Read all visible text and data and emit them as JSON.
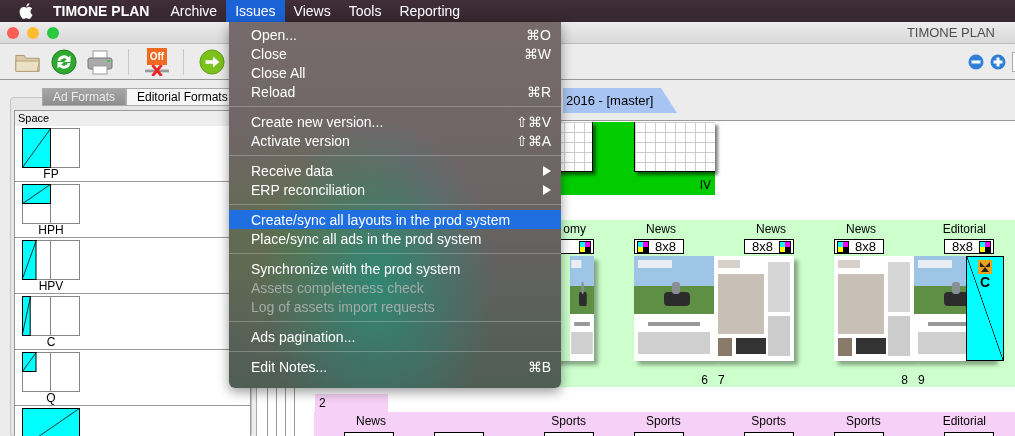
{
  "menubar": {
    "app": "TIMONE PLAN",
    "menus": [
      {
        "label": "Archive",
        "selected": false
      },
      {
        "label": "Issues",
        "selected": true
      },
      {
        "label": "Views",
        "selected": false
      },
      {
        "label": "Tools",
        "selected": false
      },
      {
        "label": "Reporting",
        "selected": false
      }
    ]
  },
  "window": {
    "title": "TIMONE PLAN"
  },
  "toolbar": {
    "offline_label": "Off"
  },
  "left_panel": {
    "tabs": [
      {
        "label": "Ad Formats",
        "selected": true
      },
      {
        "label": "Editorial Formats",
        "selected": false
      }
    ],
    "column": "Space",
    "formats": [
      {
        "kind": "fp",
        "label": "FP"
      },
      {
        "kind": "hph",
        "label": "HPH"
      },
      {
        "kind": "hpv",
        "label": "HPV"
      },
      {
        "kind": "c",
        "label": "C"
      },
      {
        "kind": "q",
        "label": "Q"
      },
      {
        "kind": "spread"
      }
    ]
  },
  "issue_tab": {
    "label": "2016 - [master]",
    "selected": true
  },
  "row_1": {
    "label": "IV"
  },
  "row_2": {
    "pages": [
      {
        "section": "omy"
      },
      {
        "section": "News",
        "badge": "8x8",
        "number": "6"
      },
      {
        "section": "News",
        "badge": "8x8",
        "number": "7"
      },
      {
        "section": "News",
        "badge": "8x8",
        "number": "8"
      },
      {
        "section": "Editorial",
        "badge": "8x8",
        "number": "9",
        "ad": {
          "label": "C"
        }
      }
    ]
  },
  "row_3": {
    "label": "2",
    "pages": [
      {
        "kind": "labelled",
        "section": "News"
      },
      {
        "kind": "blank"
      },
      {
        "kind": "labelled",
        "section": "Sports"
      },
      {
        "kind": "labelled",
        "section": "Sports"
      },
      {
        "kind": "labelled",
        "section": "Sports"
      },
      {
        "kind": "labelled",
        "section": "Sports"
      },
      {
        "kind": "labelled",
        "section": "Editorial"
      }
    ]
  },
  "issues_menu": {
    "groups": [
      [
        {
          "label": "Open...",
          "shortcut": "⌘O",
          "submenu": false,
          "disabled": false,
          "selected": false
        },
        {
          "label": "Close",
          "shortcut": "⌘W",
          "submenu": false,
          "disabled": false,
          "selected": false
        },
        {
          "label": "Close All",
          "submenu": false,
          "disabled": false,
          "selected": false
        },
        {
          "label": "Reload",
          "shortcut": "⌘R",
          "submenu": false,
          "disabled": false,
          "selected": false
        }
      ],
      [
        {
          "label": "Create new version...",
          "shortcut": "⇧⌘V",
          "submenu": false,
          "disabled": false,
          "selected": false
        },
        {
          "label": "Activate version",
          "shortcut": "⇧⌘A",
          "submenu": false,
          "disabled": false,
          "selected": false
        }
      ],
      [
        {
          "label": "Receive data",
          "submenu": true,
          "disabled": false,
          "selected": false
        },
        {
          "label": "ERP reconciliation",
          "submenu": true,
          "disabled": false,
          "selected": false
        }
      ],
      [
        {
          "label": "Create/sync all layouts in the prod system",
          "submenu": false,
          "disabled": false,
          "selected": true
        },
        {
          "label": "Place/sync all ads in the prod system",
          "submenu": false,
          "disabled": false,
          "selected": false
        }
      ],
      [
        {
          "label": "Synchronize with the prod system",
          "submenu": false,
          "disabled": false,
          "selected": false
        },
        {
          "label": "Assets completeness check",
          "submenu": false,
          "disabled": true,
          "selected": false
        },
        {
          "label": "Log of assets import requests",
          "submenu": false,
          "disabled": true,
          "selected": false
        }
      ],
      [
        {
          "label": "Ads pagination...",
          "submenu": false,
          "disabled": false,
          "selected": false
        }
      ],
      [
        {
          "label": "Edit Notes...",
          "shortcut": "⌘B",
          "submenu": false,
          "disabled": false,
          "selected": false
        }
      ]
    ]
  }
}
